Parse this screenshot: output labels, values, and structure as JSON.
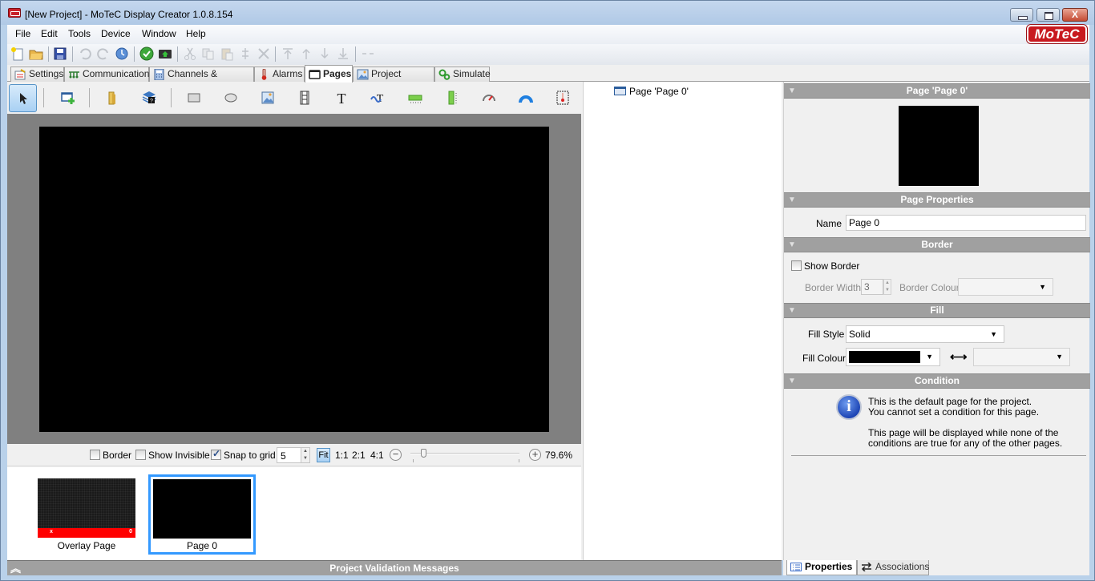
{
  "window": {
    "title": "[New Project] - MoTeC Display Creator 1.0.8.154",
    "close_label": "X",
    "brand_logo": "MoTeC"
  },
  "menu": [
    "File",
    "Edit",
    "Tools",
    "Device",
    "Window",
    "Help"
  ],
  "toolbar_icons": [
    "new-icon",
    "open-icon",
    "save-icon",
    "undo-icon",
    "redo-icon",
    "refresh-icon",
    "check-icon",
    "send-to-device-icon",
    "cut-icon",
    "copy-icon",
    "paste-icon",
    "paste-special-icon",
    "delete-icon",
    "bring-to-front-icon",
    "move-up-icon",
    "move-down-icon",
    "send-to-back-icon",
    "link-icon"
  ],
  "tabs": [
    {
      "label": "Settings",
      "icon": "settings-icon"
    },
    {
      "label": "Communications",
      "icon": "communications-icon"
    },
    {
      "label": "Channels & Functions",
      "icon": "calculator-icon"
    },
    {
      "label": "Alarms",
      "icon": "thermometer-icon"
    },
    {
      "label": "Pages",
      "icon": "page-icon",
      "active": true
    },
    {
      "label": "Project Images",
      "icon": "image-icon"
    },
    {
      "label": "Simulate",
      "icon": "gears-icon"
    }
  ],
  "tools": [
    "pointer",
    "add-page",
    "folder",
    "help-stack",
    "rectangle",
    "ellipse",
    "image",
    "film",
    "text",
    "text-wave",
    "bar-horizontal",
    "bar-vertical",
    "gauge",
    "arc",
    "thermometer-frame"
  ],
  "zoombar": {
    "border_label": "Border",
    "border_checked": false,
    "show_invisible_label": "Show Invisible",
    "show_invisible_checked": false,
    "snap_label": "Snap to grid",
    "snap_checked": true,
    "grid_value": "5",
    "fit_label": "Fit",
    "ratios": [
      "1:1",
      "2:1",
      "4:1"
    ],
    "zoom_percent": "79.6%",
    "zoom_fraction": 0.1
  },
  "thumbnails": [
    {
      "label": "Overlay Page",
      "bar_left": "x",
      "bar_right": "0"
    },
    {
      "label": "Page 0",
      "selected": true
    }
  ],
  "validation": {
    "title": "Project Validation Messages"
  },
  "tree": {
    "item": "Page 'Page 0'"
  },
  "properties": {
    "header": "Page 'Page 0'",
    "page_properties": {
      "title": "Page Properties",
      "name_label": "Name",
      "name_value": "Page 0"
    },
    "border": {
      "title": "Border",
      "show_border_label": "Show Border",
      "show_border_checked": false,
      "width_label": "Border Width",
      "width_value": "3",
      "colour_label": "Border Colour"
    },
    "fill": {
      "title": "Fill",
      "style_label": "Fill Style",
      "style_value": "Solid",
      "colour_label": "Fill Colour",
      "colour_value": "#000000",
      "swap_symbol": "⟷"
    },
    "condition": {
      "title": "Condition",
      "line1": "This is the default page for the project.",
      "line2": "You cannot set a condition for this page.",
      "line3": "This page will be displayed while none of the",
      "line4": "conditions are true for any of the other pages."
    }
  },
  "bottom_tabs": [
    {
      "label": "Properties",
      "active": true
    },
    {
      "label": "Associations"
    }
  ],
  "colors": {
    "selection": "#3399ff",
    "motec_red": "#c8191f",
    "section_grey": "#a0a0a0"
  }
}
